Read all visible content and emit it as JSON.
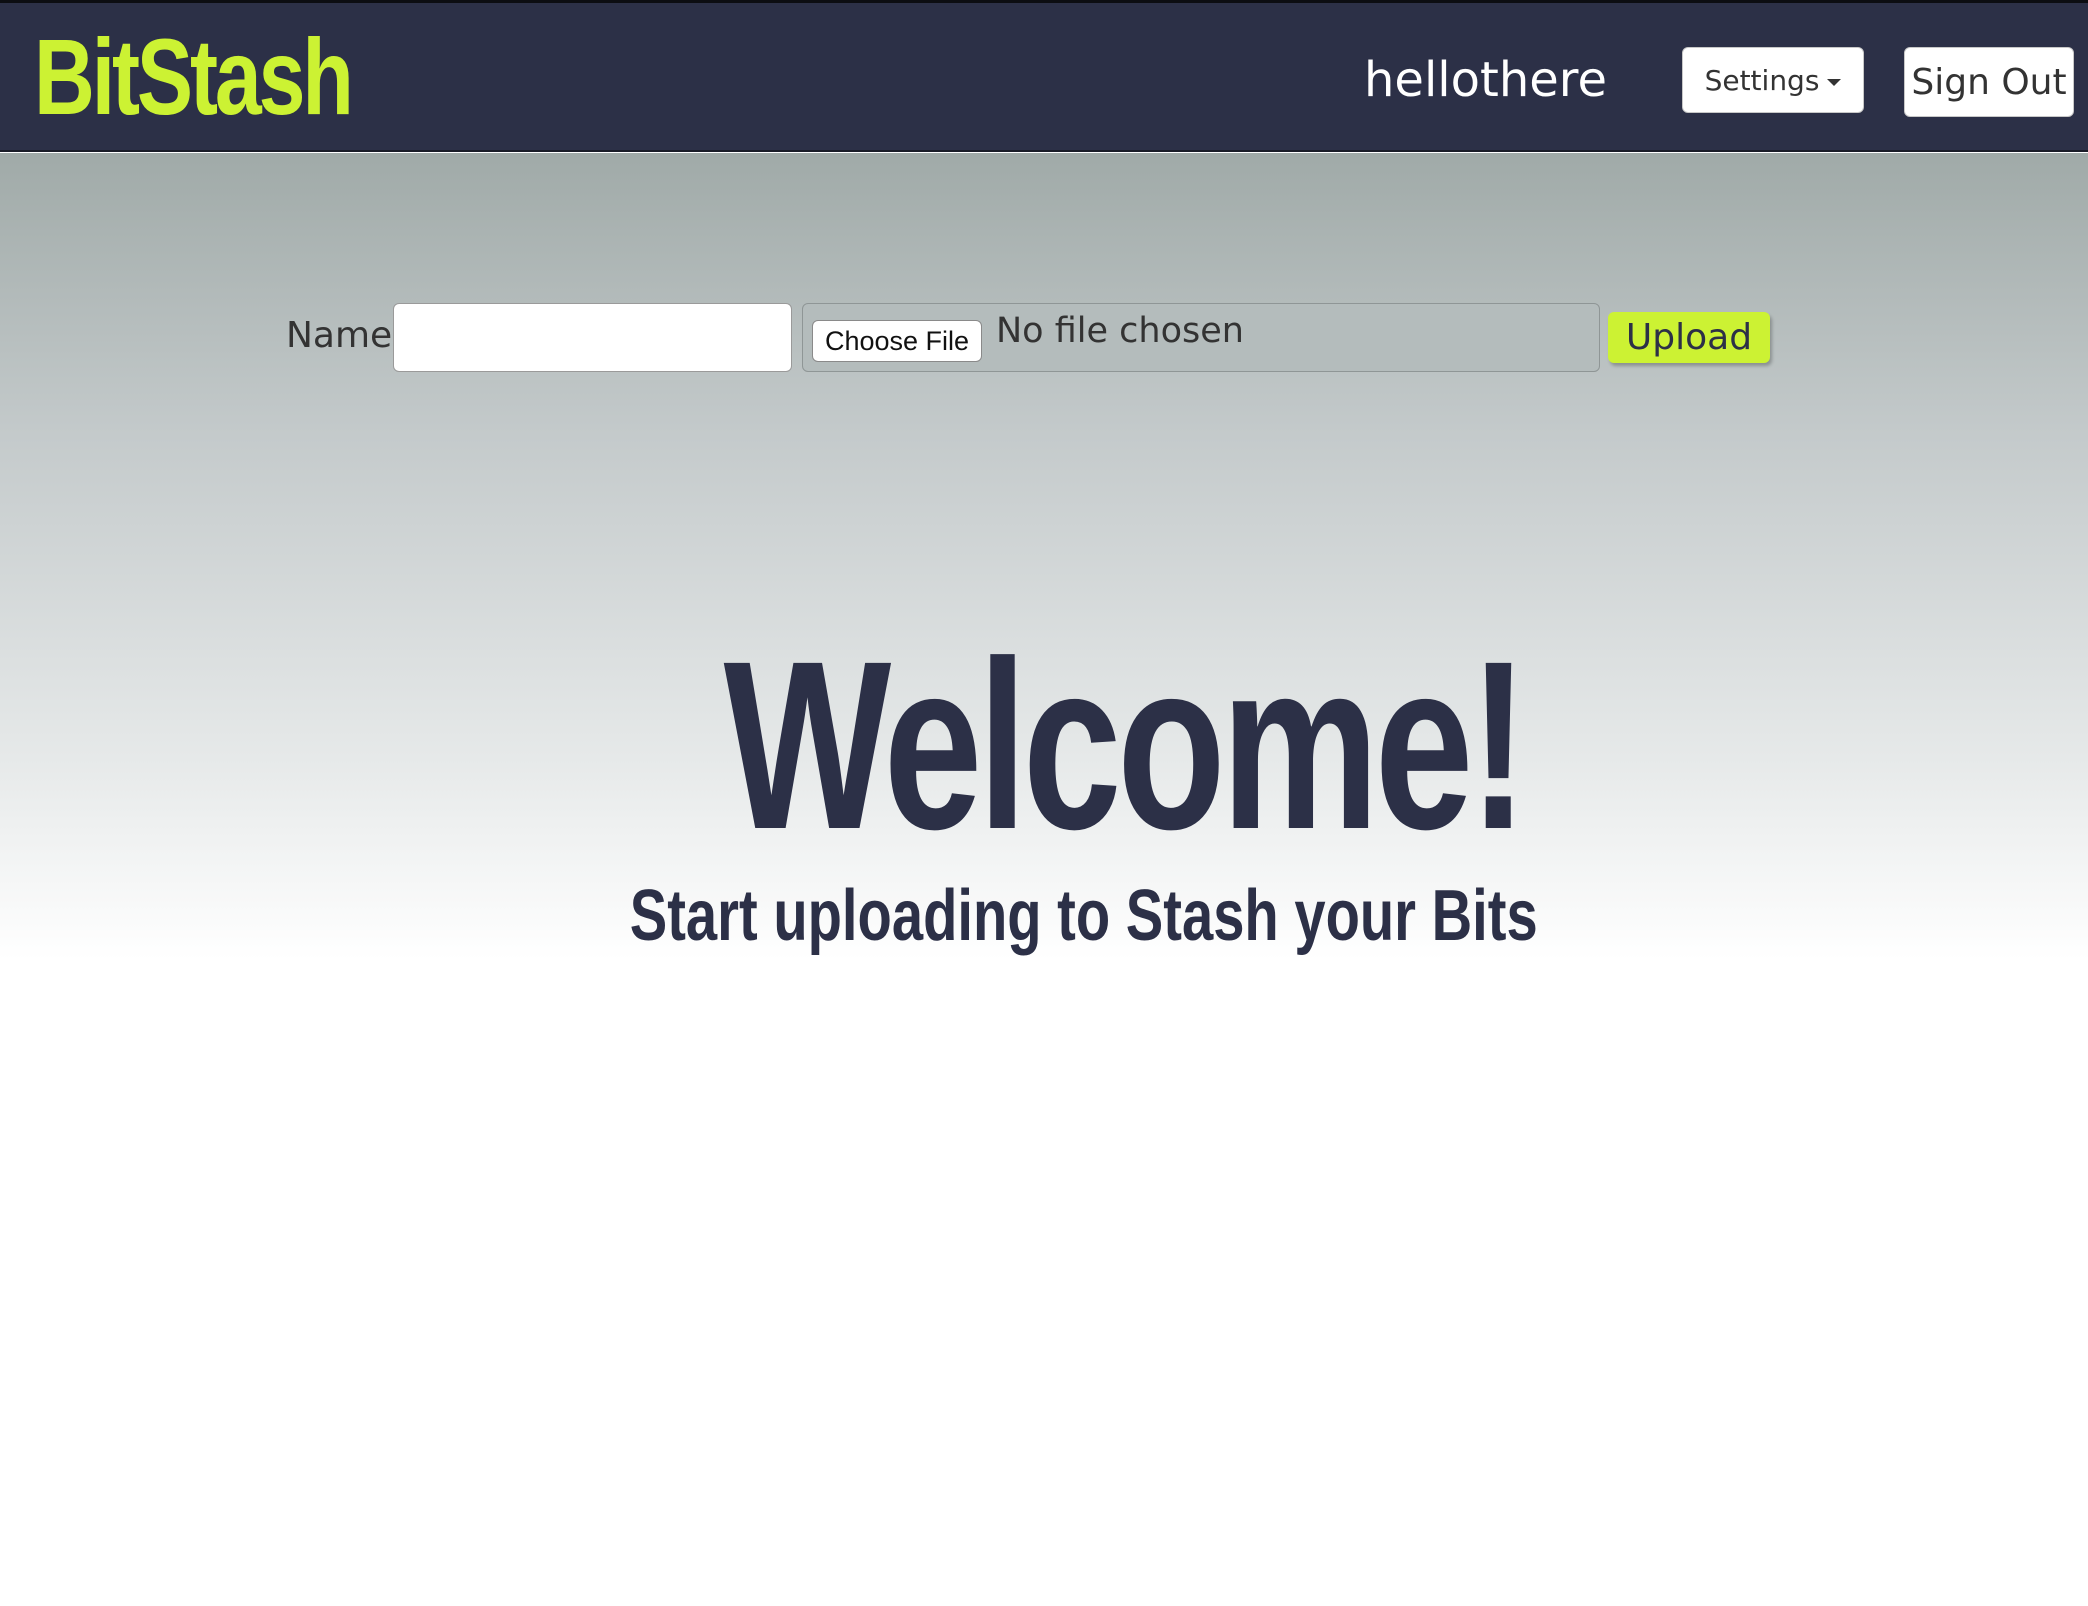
{
  "navbar": {
    "brand": "BitStash",
    "username": "hellothere",
    "settings_label": "Settings",
    "signout_label": "Sign Out"
  },
  "upload_form": {
    "name_label": "Name",
    "name_value": "",
    "choose_file_label": "Choose File",
    "no_file_text": "No file chosen",
    "upload_label": "Upload"
  },
  "hero": {
    "title": "Welcome!",
    "subtitle": "Start uploading to Stash your Bits"
  },
  "colors": {
    "navbar_bg": "#2c3047",
    "accent": "#ccf233",
    "text_dark": "#2c3047"
  }
}
